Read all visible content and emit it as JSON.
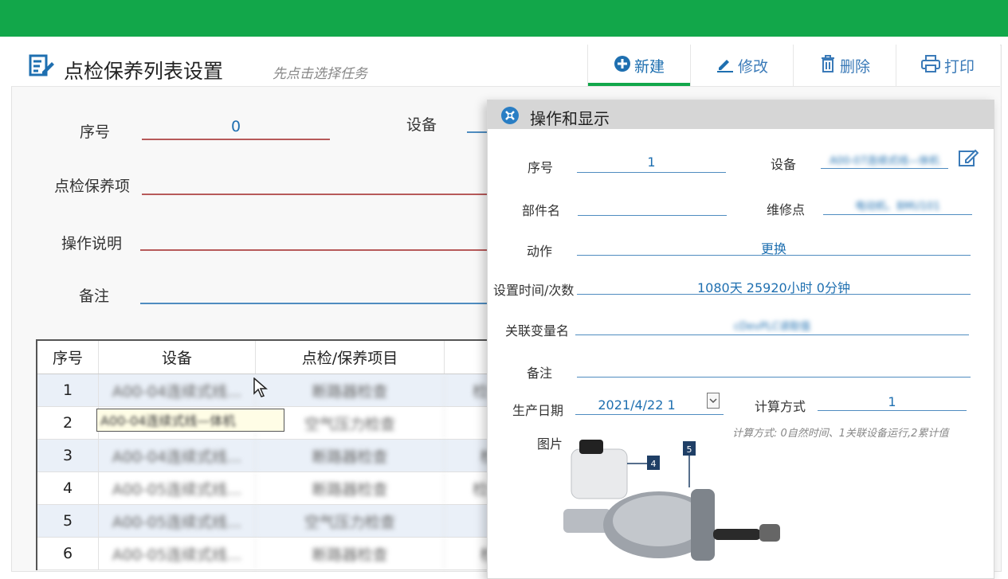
{
  "header": {
    "title": "点检保养列表设置",
    "hint": "先点击选择任务"
  },
  "toolbar": {
    "new_label": "新建",
    "edit_label": "修改",
    "delete_label": "删除",
    "print_label": "打印"
  },
  "form": {
    "seq_label": "序号",
    "seq_value": "0",
    "device_label": "设备",
    "item_label": "点检保养项",
    "desc_label": "操作说明",
    "note_label": "备注"
  },
  "table": {
    "headers": [
      "序号",
      "设备",
      "点检/保养项目",
      ""
    ],
    "rows": [
      {
        "seq": "1",
        "device": "A00-04连续式线...",
        "item": "断路器检查",
        "extra": "检查"
      },
      {
        "seq": "2",
        "device": "",
        "item": "空气压力检查",
        "extra": ""
      },
      {
        "seq": "3",
        "device": "A00-04连续式线...",
        "item": "断路器检查",
        "extra": "检"
      },
      {
        "seq": "4",
        "device": "A00-05连续式线...",
        "item": "断路器检查",
        "extra": "检查"
      },
      {
        "seq": "5",
        "device": "A00-05连续式线...",
        "item": "空气压力检查",
        "extra": ""
      },
      {
        "seq": "6",
        "device": "A00-05连续式线...",
        "item": "断路器检查",
        "extra": "检"
      }
    ],
    "tooltip": "A00-04连续式线—体机"
  },
  "panel": {
    "title": "操作和显示",
    "seq_label": "序号",
    "seq_value": "1",
    "device_label": "设备",
    "device_value": "A00-07连续式线—体机",
    "part_label": "部件名",
    "part_value": "",
    "repair_label": "维修点",
    "repair_value": "电动机、BMU101",
    "action_label": "动作",
    "action_value": "更换",
    "time_label": "设置时间/次数",
    "time_value": "1080天 25920小时 0分钟",
    "var_label": "关联变量名",
    "var_value": "cDevPLC读取值",
    "note_label": "备注",
    "note_value": "",
    "date_label": "生产日期",
    "date_value": "2021/4/22 1",
    "calc_label": "计算方式",
    "calc_value": "1",
    "calc_note": "计算方式: 0自然时间、1关联设备运行,2累计值",
    "image_label": "图片",
    "callout_4": "4",
    "callout_5": "5"
  }
}
